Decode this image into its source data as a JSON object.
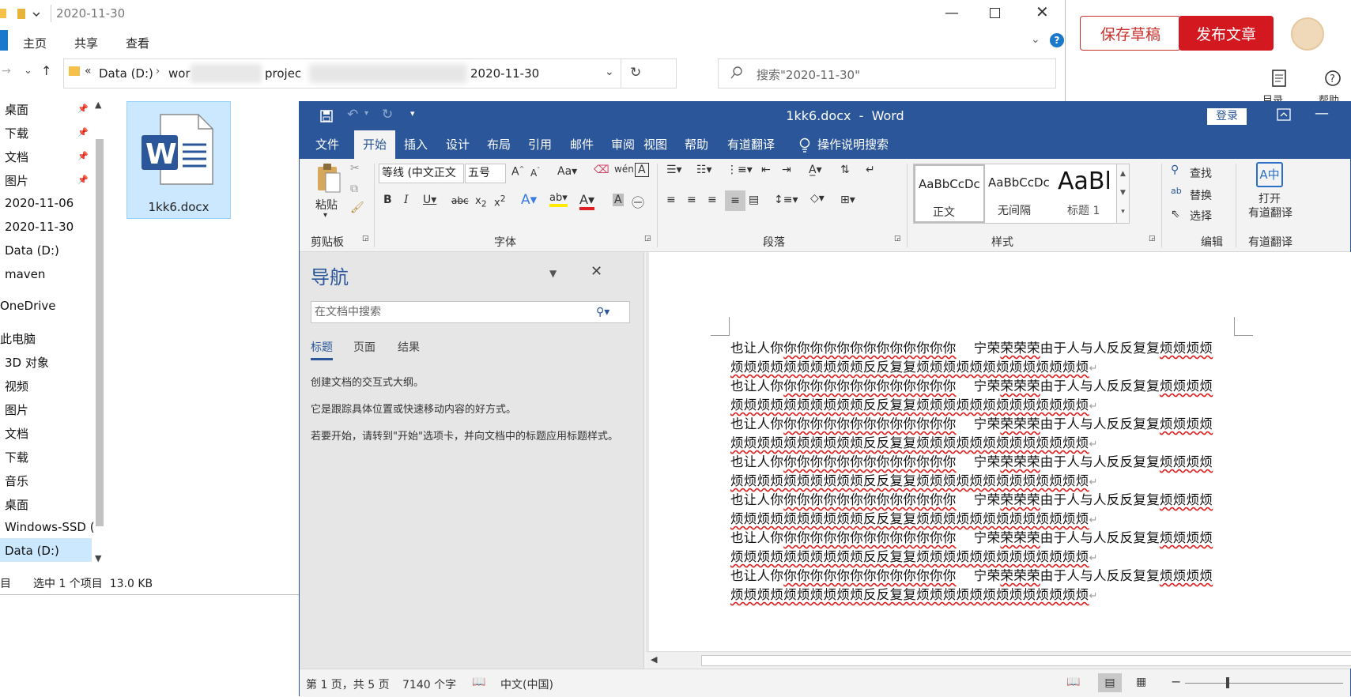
{
  "web_editor": {
    "save_draft": "保存草稿",
    "publish": "发布文章",
    "toc_label": "目录",
    "help_label": "帮助",
    "brand_color": "#d4181f"
  },
  "explorer": {
    "title": "2020-11-30",
    "ribbon_tabs": [
      "主页",
      "共享",
      "查看"
    ],
    "breadcrumb": [
      "Data (D:)",
      "wor",
      "projec",
      "2020-11-30"
    ],
    "search_placeholder": "搜索\"2020-11-30\"",
    "sidebar": [
      "桌面",
      "下载",
      "文档",
      "图片",
      "2020-11-06",
      "2020-11-30",
      "Data (D:)",
      "maven",
      "OneDrive",
      "此电脑",
      "3D 对象",
      "视频",
      "图片",
      "文档",
      "下载",
      "音乐",
      "桌面",
      "Windows-SSD (",
      "Data (D:)"
    ],
    "file_name": "1kk6.docx",
    "status_items": "目",
    "status_selected": "选中 1 个项目  13.0 KB"
  },
  "word": {
    "title": "1kk6.docx  -  Word",
    "login": "登录",
    "tabs": [
      "文件",
      "开始",
      "插入",
      "设计",
      "布局",
      "引用",
      "邮件",
      "审阅",
      "视图",
      "帮助",
      "有道翻译",
      "操作说明搜索"
    ],
    "ribbon": {
      "paste": "粘贴",
      "clipboard": "剪贴板",
      "font_name": "等线 (中文正文",
      "font_size": "五号",
      "font_group": "字体",
      "paragraph_group": "段落",
      "styles_group": "样式",
      "style_items": [
        {
          "preview": "AaBbCcDc",
          "name": "正文"
        },
        {
          "preview": "AaBbCcDc",
          "name": "无间隔"
        },
        {
          "preview": "AaBl",
          "name": "标题 1"
        }
      ],
      "find": "查找",
      "replace": "替换",
      "select": "选择",
      "edit_group": "编辑",
      "open_youdao": "打开",
      "youdao_translate": "有道翻译",
      "youdao_group": "有道翻译"
    },
    "nav": {
      "title": "导航",
      "search_placeholder": "在文档中搜索",
      "tabs": [
        "标题",
        "页面",
        "结果"
      ],
      "text1": "创建文档的交互式大纲。",
      "text2": "它是跟踪具体位置或快速移动内容的好方式。",
      "text3": "若要开始，请转到\"开始\"选项卡，并向文档中的标题应用标题样式。"
    },
    "doc": {
      "line1_a": "也让人你",
      "line1_b": "你你你你你你你你你你你你你",
      "line1_c": "    宁荣",
      "line1_d": "荣荣荣",
      "line1_e": "由于人与人反反复复",
      "line1_f": "烦烦烦烦",
      "line2": "烦烦烦烦烦烦烦烦烦烦反反复复烦烦烦烦烦烦烦烦烦烦烦烦烦",
      "paragraph_mark": "↵"
    },
    "status": {
      "page": "第 1 页，共 5 页",
      "words": "7140 个字",
      "lang": "中文(中国)"
    }
  }
}
